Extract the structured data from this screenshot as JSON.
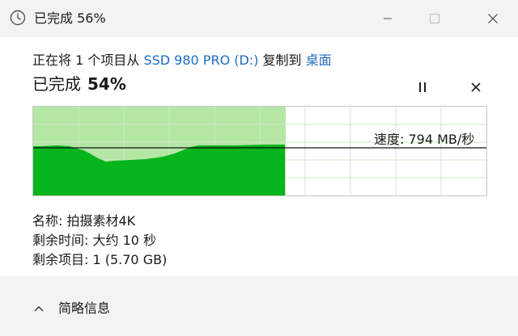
{
  "window": {
    "title": "已完成 56%"
  },
  "copy": {
    "prefix": "正在将 1 个项目从 ",
    "source": "SSD 980 PRO (D:)",
    "middle": " 复制到 ",
    "destination": "桌面"
  },
  "progress": {
    "label": "已完成",
    "percent_text": "54%",
    "percent_value": 54
  },
  "speed": {
    "label": "速度: 794 MB/秒"
  },
  "details": {
    "name": "名称: 拍摄素材4K",
    "time_remaining": "剩余时间: 大约 10 秒",
    "items_remaining": "剩余项目: 1 (5.70 GB)"
  },
  "footer": {
    "toggle_label": "简略信息"
  },
  "icons": {
    "app": "clock-icon",
    "minimize": "minimize-icon",
    "maximize": "maximize-icon",
    "close": "close-icon",
    "pause": "pause-icon",
    "cancel": "cancel-icon",
    "toggle": "chevron-up-icon"
  },
  "colors": {
    "progress_fill": "#b4e6a4",
    "speed_area": "#06b41c",
    "link": "#1f6bc0",
    "titlebar": "#f3f3f3"
  }
}
